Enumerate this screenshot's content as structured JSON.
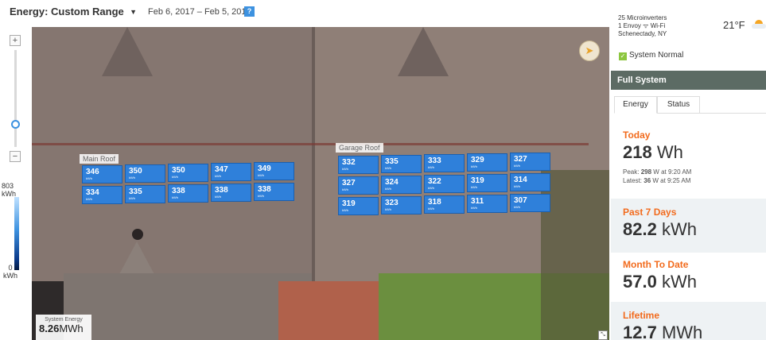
{
  "header": {
    "energy_select": "Energy: Custom Range",
    "date_range": "Feb 6, 2017 – Feb 5, 2018",
    "calendar_icon": "calendar-icon"
  },
  "zoom": {
    "plus": "+",
    "minus": "−"
  },
  "legend": {
    "max_value": "803",
    "max_unit": "kWh",
    "min_value": "0",
    "min_unit": "kWh"
  },
  "map": {
    "arrays": [
      {
        "label": "Main Roof"
      },
      {
        "label": "Garage Roof"
      }
    ],
    "main_roof_panels": [
      "346",
      "350",
      "350",
      "347",
      "349",
      "334",
      "335",
      "338",
      "338",
      "338"
    ],
    "garage_roof_panels": [
      "332",
      "335",
      "333",
      "329",
      "327",
      "327",
      "324",
      "322",
      "319",
      "314",
      "319",
      "323",
      "318",
      "311",
      "307"
    ],
    "panel_unit": "kWh",
    "system_energy_title": "System Energy",
    "system_energy_value": "8.26",
    "system_energy_unit": "MWh"
  },
  "sidebar": {
    "microinverters": "25 Microinverters",
    "envoy_prefix": "1 Envoy",
    "envoy_suffix": "Wi-Fi",
    "location": "Schenectady, NY",
    "temperature": "21°F",
    "status": "System Normal",
    "section_title": "Full System",
    "tabs": [
      {
        "label": "Energy"
      },
      {
        "label": "Status"
      }
    ],
    "today": {
      "label": "Today",
      "value": "218",
      "unit": "Wh",
      "peak_prefix": "Peak:",
      "peak_value": "298",
      "peak_suffix": "W at 9:20 AM",
      "latest_prefix": "Latest:",
      "latest_value": "36",
      "latest_suffix": "W at 9:25 AM"
    },
    "past7": {
      "label": "Past 7 Days",
      "value": "82.2",
      "unit": "kWh"
    },
    "month": {
      "label": "Month To Date",
      "value": "57.0",
      "unit": "kWh"
    },
    "lifetime": {
      "label": "Lifetime",
      "value": "12.7",
      "unit": "MWh"
    }
  },
  "colors": {
    "panel": "#2f80da",
    "accent_orange": "#f26b1d",
    "status_green": "#8cc63f",
    "header_dark": "#5c6b64"
  }
}
